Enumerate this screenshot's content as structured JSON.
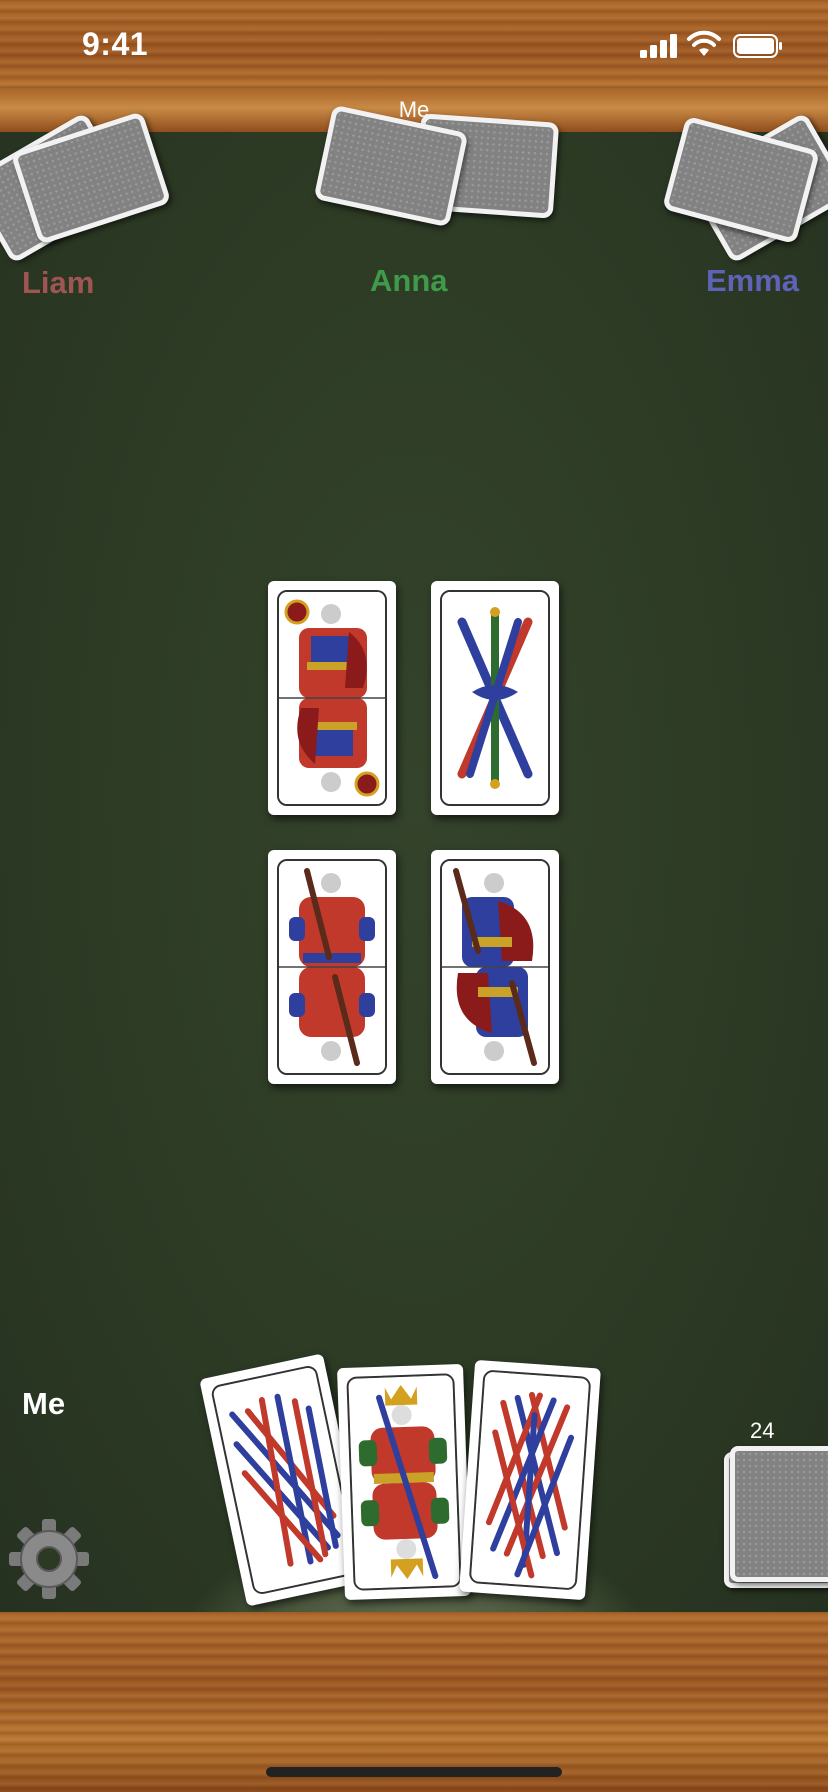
{
  "status_bar": {
    "time": "9:41"
  },
  "title_bar": {
    "title": "Me"
  },
  "players": {
    "left": {
      "name": "Liam",
      "color": "#a05555"
    },
    "top": {
      "name": "Anna",
      "color": "#3f9a4a"
    },
    "right": {
      "name": "Emma",
      "color": "#5f63b8"
    },
    "self": {
      "name": "Me"
    }
  },
  "table_cards": [
    {
      "suit": "coins",
      "rank": "knight"
    },
    {
      "suit": "batons",
      "rank": "4"
    },
    {
      "suit": "batons",
      "rank": "jack"
    },
    {
      "suit": "batons",
      "rank": "knight"
    }
  ],
  "hand_cards": [
    {
      "suit": "batons",
      "rank": "8"
    },
    {
      "suit": "swords",
      "rank": "king"
    },
    {
      "suit": "batons",
      "rank": "9"
    }
  ],
  "deck": {
    "count": "24"
  },
  "icons": {
    "settings": "gear-icon"
  },
  "colors": {
    "felt": "#2c3a24",
    "wood": "#a6612a"
  }
}
